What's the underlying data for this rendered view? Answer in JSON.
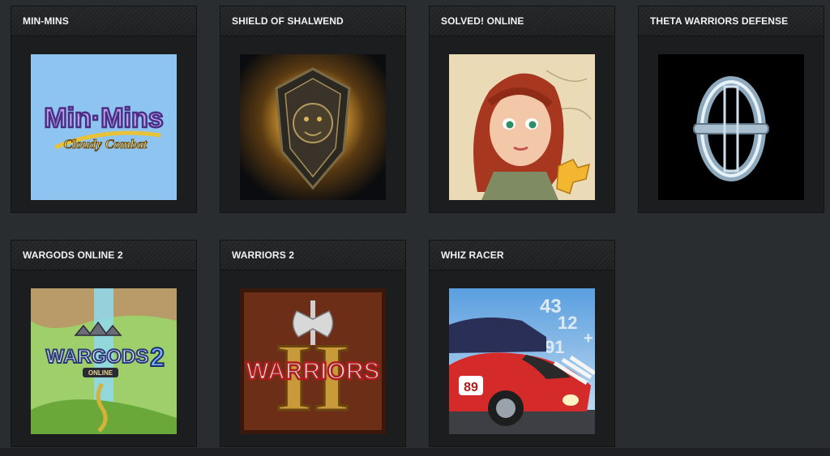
{
  "games": [
    {
      "title": "MIN-MINS",
      "logo_line1": "Min·Mins",
      "logo_line2": "Cloudy Combat",
      "icon": "min-mins-logo"
    },
    {
      "title": "SHIELD OF SHALWEND",
      "icon": "lion-shield-icon"
    },
    {
      "title": "SOLVED! ONLINE",
      "icon": "redhead-girl-puzzle-icon"
    },
    {
      "title": "THETA WARRIORS DEFENSE",
      "icon": "theta-emblem-icon"
    },
    {
      "title": "WARGODS ONLINE 2",
      "logo_line1": "WARGODS",
      "logo_num": "2",
      "logo_line2": "ONLINE",
      "icon": "wargods-logo"
    },
    {
      "title": "WARRIORS 2",
      "logo_line1": "WARRIORS",
      "logo_num": "II",
      "icon": "warriors-axe-logo"
    },
    {
      "title": "WHIZ RACER",
      "car_number": "89",
      "bg_numbers": [
        "43",
        "12",
        "91",
        "+"
      ],
      "icon": "race-car-icon"
    }
  ],
  "colors": {
    "background": "#2a2d30",
    "card": "#1b1d1f",
    "header_text": "#f2f2f2"
  }
}
